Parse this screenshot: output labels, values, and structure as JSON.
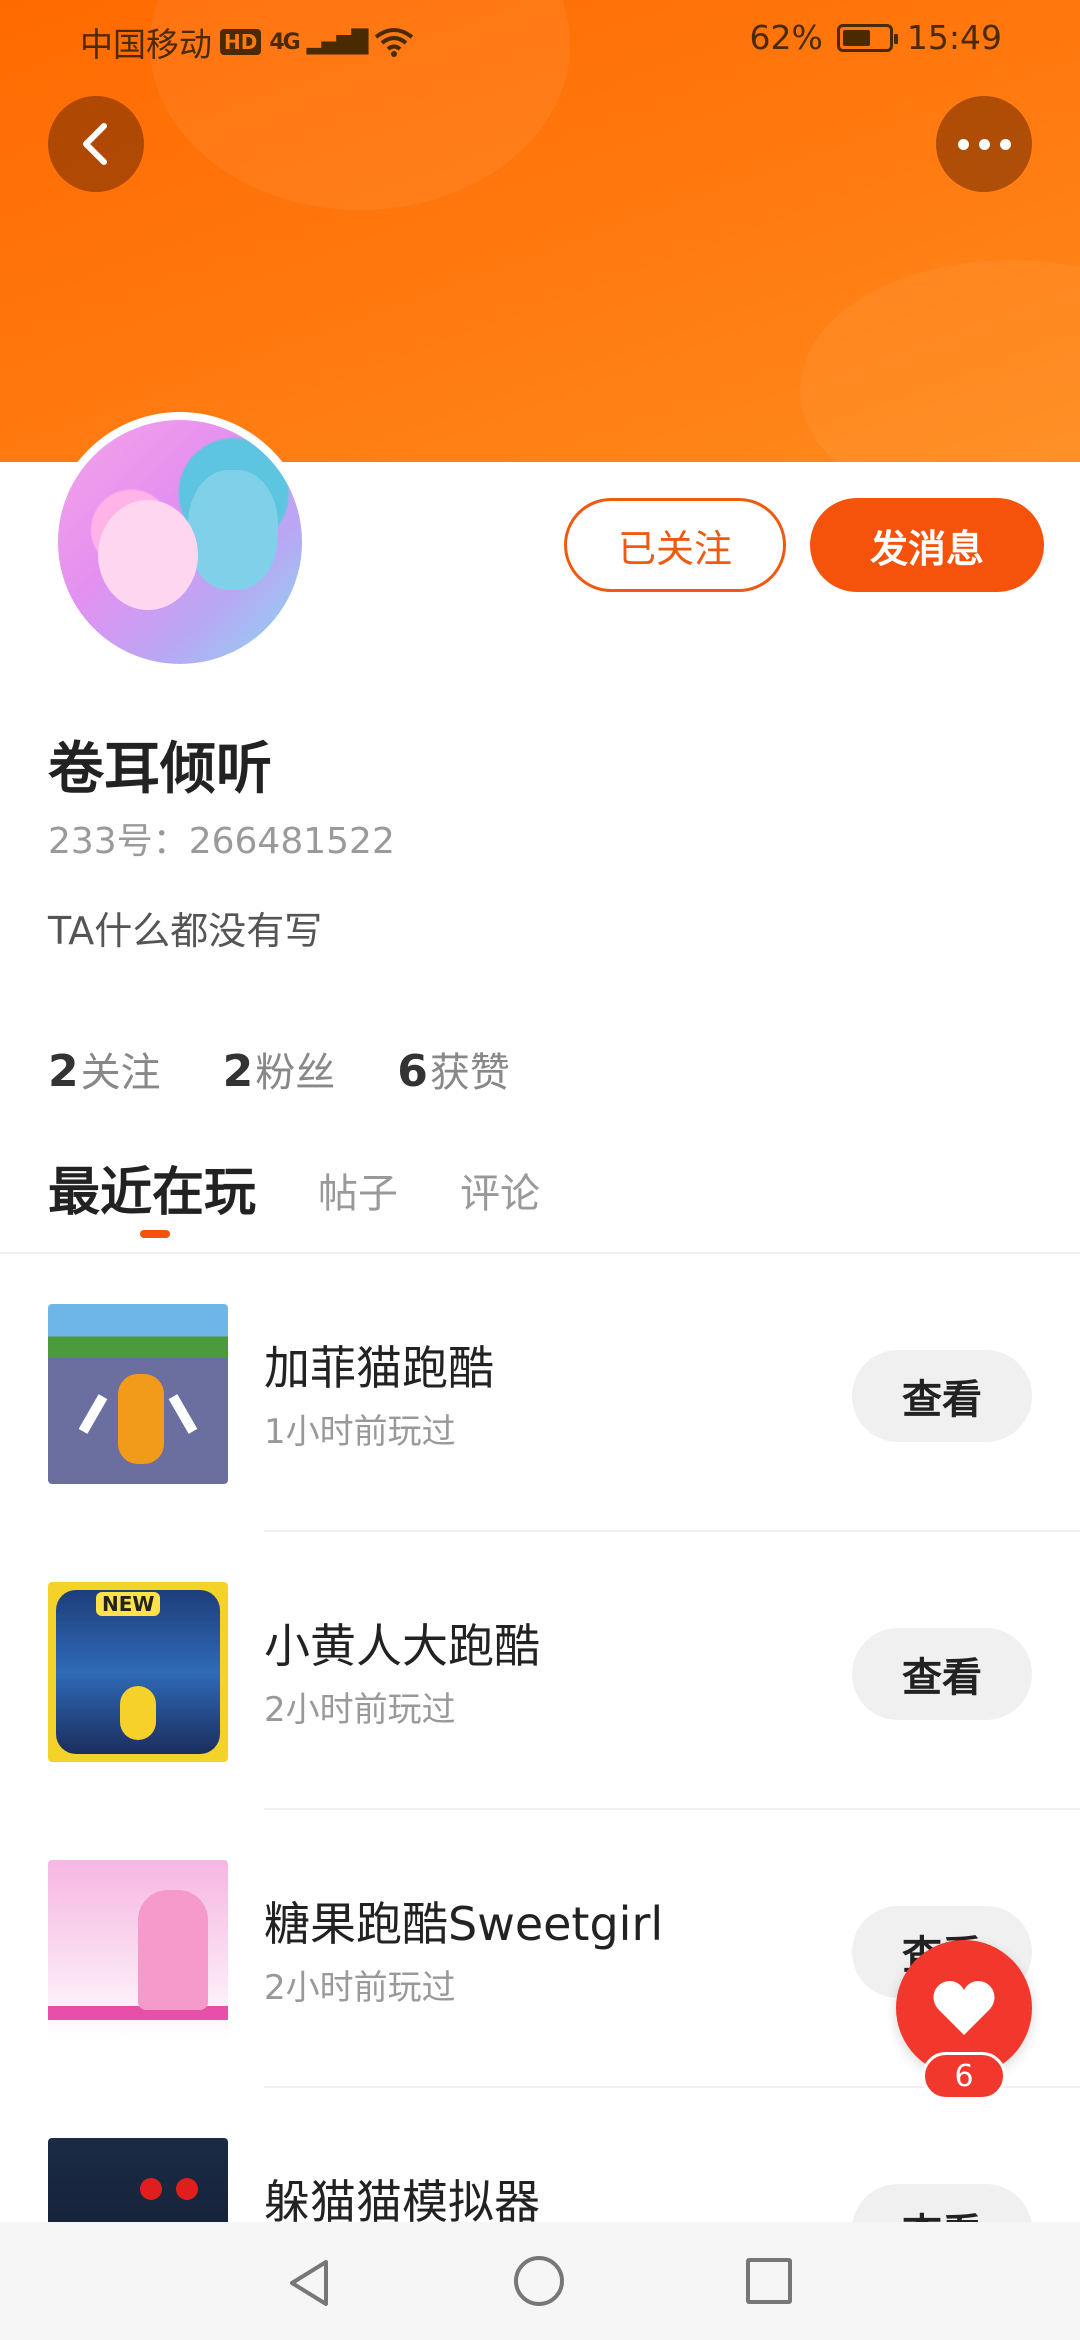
{
  "status_bar": {
    "carrier": "中国移动",
    "hd": "HD",
    "network": "4G",
    "battery": "62%",
    "battery_level": 0.62,
    "time": "15:49"
  },
  "profile": {
    "username": "卷耳倾听",
    "uid_label": "233号：266481522",
    "bio": "TA什么都没有写",
    "followed_label": "已关注",
    "message_label": "发消息",
    "stats": [
      {
        "num": "2",
        "label": "关注"
      },
      {
        "num": "2",
        "label": "粉丝"
      },
      {
        "num": "6",
        "label": "获赞"
      }
    ]
  },
  "tabs": {
    "recent": "最近在玩",
    "posts": "帖子",
    "comments": "评论"
  },
  "games": [
    {
      "title": "加菲猫跑酷",
      "time": "1小时前玩过",
      "action": "查看"
    },
    {
      "title": "小黄人大跑酷",
      "time": "2小时前玩过",
      "action": "查看",
      "badge": "NEW"
    },
    {
      "title": "糖果跑酷Sweetgirl",
      "time": "2小时前玩过",
      "action": "查看"
    },
    {
      "title": "躲猫猫模拟器",
      "time": "",
      "action": "查看"
    }
  ],
  "like_fab": {
    "count": "6"
  },
  "colors": {
    "accent": "#f5520c",
    "banner": "#ff7a10",
    "like": "#f2382c"
  }
}
